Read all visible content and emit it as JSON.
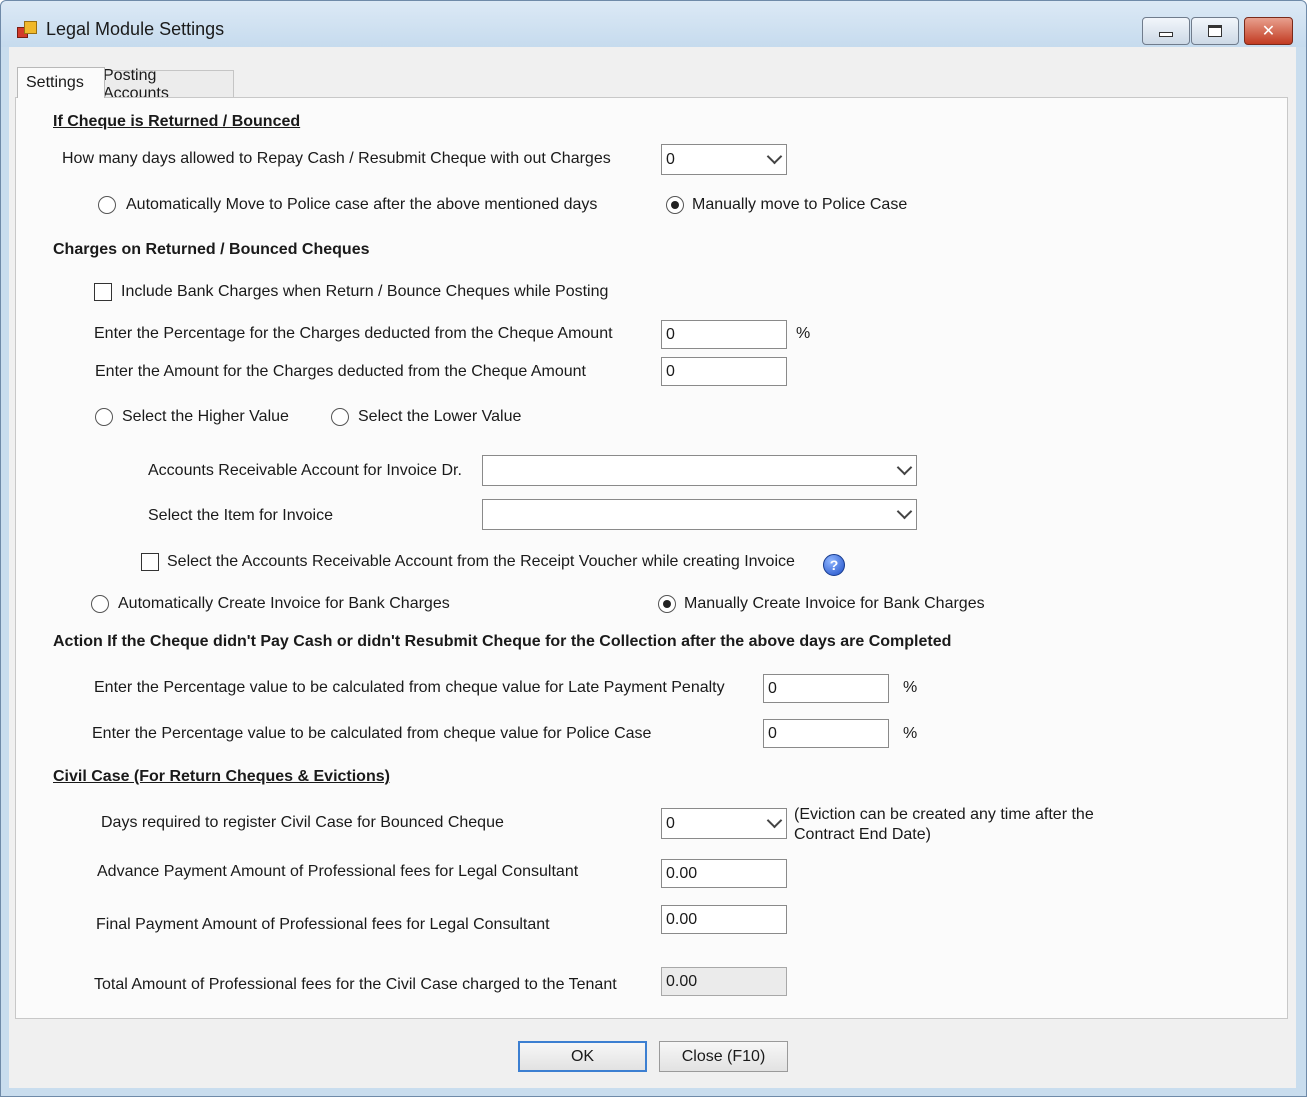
{
  "window": {
    "title": "Legal Module Settings",
    "icons": {
      "minimize": "minimize-icon",
      "maximize": "maximize-icon",
      "close": "close-icon"
    }
  },
  "tabs": [
    {
      "label": "Settings",
      "active": true
    },
    {
      "label": "Posting Accounts",
      "active": false
    }
  ],
  "section1": {
    "title": "If Cheque is Returned / Bounced",
    "days_label": "How many days allowed to Repay Cash / Resubmit Cheque with out Charges",
    "days_value": "0",
    "auto_move_label": "Automatically Move to Police case after the above mentioned days",
    "manual_move_label": "Manually move to Police Case",
    "selected": "manual"
  },
  "section2": {
    "title": "Charges on Returned  / Bounced Cheques",
    "include_bank_charges_label": "Include Bank Charges when Return / Bounce Cheques while Posting",
    "include_bank_charges_checked": false,
    "percentage_label": "Enter the Percentage for the Charges deducted from the Cheque Amount",
    "percentage_value": "0",
    "percent_sign": "%",
    "amount_label": "Enter the Amount for the Charges deducted from the Cheque Amount",
    "amount_value": "0",
    "higher_value_label": "Select the Higher Value",
    "lower_value_label": "Select the Lower Value",
    "ar_account_label": "Accounts Receivable Account for Invoice Dr.",
    "ar_account_value": "",
    "item_label": "Select the Item for Invoice",
    "item_value": "",
    "receipt_voucher_label": "Select the Accounts Receivable  Account from the Receipt Voucher while creating Invoice",
    "receipt_voucher_checked": false,
    "help_icon": "help-icon",
    "auto_invoice_label": "Automatically Create Invoice for Bank Charges",
    "manual_invoice_label": "Manually Create Invoice for Bank Charges",
    "invoice_selected": "manual"
  },
  "section3": {
    "title": "Action If the Cheque didn't Pay Cash  or didn't  Resubmit Cheque for the Collection after the above days are Completed",
    "late_penalty_label": "Enter the Percentage value to be calculated from cheque value for Late Payment Penalty",
    "late_penalty_value": "0",
    "police_case_label": "Enter the Percentage value to be calculated from cheque value for Police Case",
    "police_case_value": "0",
    "percent_sign": "%"
  },
  "section4": {
    "title": "Civil Case (For Return Cheques  & Evictions)",
    "days_label": "Days required to register Civil Case for Bounced Cheque",
    "days_value": "0",
    "eviction_note_line1": "(Eviction can be created any time after the",
    "eviction_note_line2": "Contract End Date)",
    "advance_label": "Advance Payment Amount of Professional fees for Legal Consultant",
    "advance_value": "0.00",
    "final_label": "Final Payment Amount of Professional fees for Legal Consultant",
    "final_value": "0.00",
    "total_label": "Total Amount of Professional fees for the Civil Case charged to the Tenant",
    "total_value": "0.00"
  },
  "buttons": {
    "ok_label": "OK",
    "close_label": "Close (F10)"
  }
}
